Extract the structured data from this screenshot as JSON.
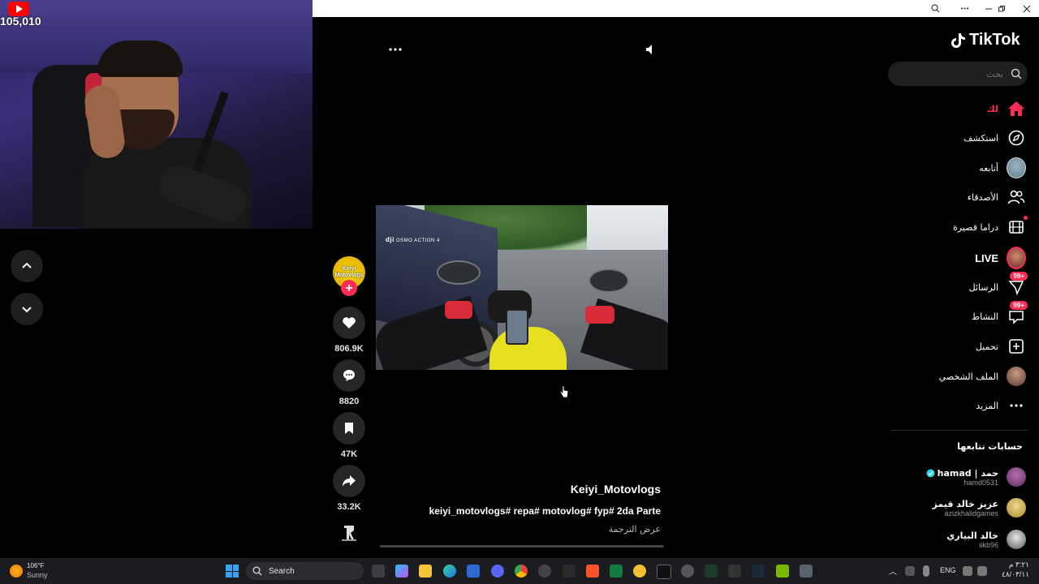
{
  "stream_overlay": {
    "viewer_count": "105,010"
  },
  "window": {
    "controls": [
      "zoom-icon",
      "more-icon",
      "minimize-icon",
      "restore-icon",
      "close-icon"
    ]
  },
  "video": {
    "watermark": "OSMO ACTION 4",
    "author_username": "Keiyi_Motovlogs",
    "caption": "keiyi_motovlogs# repa# motovlog# fyp# 2da Parte",
    "translate_link": "عرض الترجمة",
    "avatar_text": "Keiyi Motovlogs"
  },
  "actions": {
    "likes": "806.9K",
    "comments": "8820",
    "saves": "47K",
    "shares": "33.2K"
  },
  "sidebar": {
    "logo": "TikTok",
    "search_placeholder": "بحث",
    "nav": [
      {
        "label": "لك",
        "icon": "home-icon",
        "active": true
      },
      {
        "label": "استكشف",
        "icon": "compass-icon"
      },
      {
        "label": "أتابعه",
        "icon": "following-avatar"
      },
      {
        "label": "الأصدقاء",
        "icon": "friends-icon"
      },
      {
        "label": "دراما قصيرة",
        "icon": "film-icon"
      },
      {
        "label": "LIVE",
        "icon": "live-avatar"
      },
      {
        "label": "الرسائل",
        "icon": "messages-icon",
        "badge": "99+"
      },
      {
        "label": "النشاط",
        "icon": "activity-icon",
        "badge": "99+"
      },
      {
        "label": "تحميل",
        "icon": "upload-icon"
      },
      {
        "label": "الملف الشخصي",
        "icon": "profile-avatar"
      },
      {
        "label": "المزيد",
        "icon": "more-icon"
      }
    ],
    "following_title": "حسابات تتابعها",
    "following": [
      {
        "name": "hamad | حمد",
        "handle": "hamd0531",
        "verified": true
      },
      {
        "name": "عزيز خالد قيمز",
        "handle": "azizkhalidgames",
        "verified": false
      },
      {
        "name": "خالد البياري",
        "handle": "iikb96",
        "verified": false
      }
    ]
  },
  "taskbar": {
    "weather_temp": "106°F",
    "weather_desc": "Sunny",
    "search_placeholder": "Search",
    "language": "ENG",
    "time": "٣:٢١ م",
    "date": "٤٨/٠٣/١١"
  },
  "colors": {
    "accent": "#fe2c55",
    "background": "#000000",
    "taskbar": "#1b1c20"
  }
}
